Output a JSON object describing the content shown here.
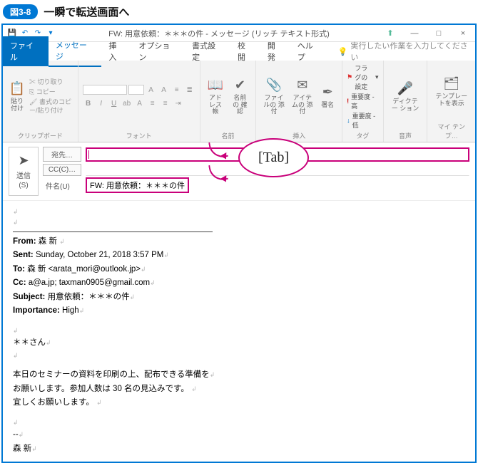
{
  "figure": {
    "badge": "図3-8",
    "title": "一瞬で転送画面へ"
  },
  "titlebar": {
    "text": "FW: 用意依頼：＊＊＊の件 - メッセージ (リッチ テキスト形式)"
  },
  "win_controls": {
    "min": "—",
    "max": "□",
    "close": "×"
  },
  "tabs": {
    "file": "ファイル",
    "message": "メッセージ",
    "insert": "挿入",
    "options": "オプション",
    "format": "書式設定",
    "review": "校閲",
    "dev": "開発",
    "help": "ヘルプ",
    "tell_me": "実行したい作業を入力してください"
  },
  "ribbon": {
    "clipboard": {
      "paste": "貼り付け",
      "cut": "切り取り",
      "copy": "コピー",
      "painter": "書式のコピー/貼り付け",
      "label": "クリップボード"
    },
    "font": {
      "label": "フォント"
    },
    "names": {
      "addr": "アドレス帳",
      "check": "名前の\n確認",
      "label": "名前"
    },
    "insert": {
      "attach_file": "ファイルの\n添付",
      "attach_item": "アイテムの\n添付",
      "sig": "署名",
      "label": "挿入"
    },
    "tags": {
      "flag": "フラグの設定",
      "hi": "重要度 - 高",
      "lo": "重要度 - 低",
      "label": "タグ"
    },
    "voice": {
      "dictate": "ディクテー\nション",
      "label": "音声"
    },
    "templates": {
      "view": "テンプレー\nトを表示",
      "label": "マイ テンプ…"
    }
  },
  "compose": {
    "send": "送信",
    "send_key": "(S)",
    "to_btn": "宛先…",
    "cc_btn": "CC(C)…",
    "subject_lbl": "件名(U)",
    "subject_val": "FW: 用意依頼：＊＊＊の件"
  },
  "balloon": "[Tab]",
  "forwarded": {
    "from_lbl": "From:",
    "from_val": "森 新",
    "sent_lbl": "Sent:",
    "sent_val": "Sunday, October 21, 2018 3:57 PM",
    "to_lbl": "To:",
    "to_val": "森 新 <arata_mori@outlook.jp>",
    "cc_lbl": "Cc:",
    "cc_val": "a@a.jp; taxman0905@gmail.com",
    "subj_lbl": "Subject:",
    "subj_val": "用意依頼：＊＊＊の件",
    "imp_lbl": "Importance:",
    "imp_val": "High"
  },
  "body": {
    "greet": "＊＊さん",
    "p1": "本日のセミナーの資料を印刷の上、配布できる準備を",
    "p2": "お願いします。参加人数は 30 名の見込みです。",
    "p3": "宜しくお願いします。",
    "sig_sep": "--",
    "sig": "森 新"
  }
}
